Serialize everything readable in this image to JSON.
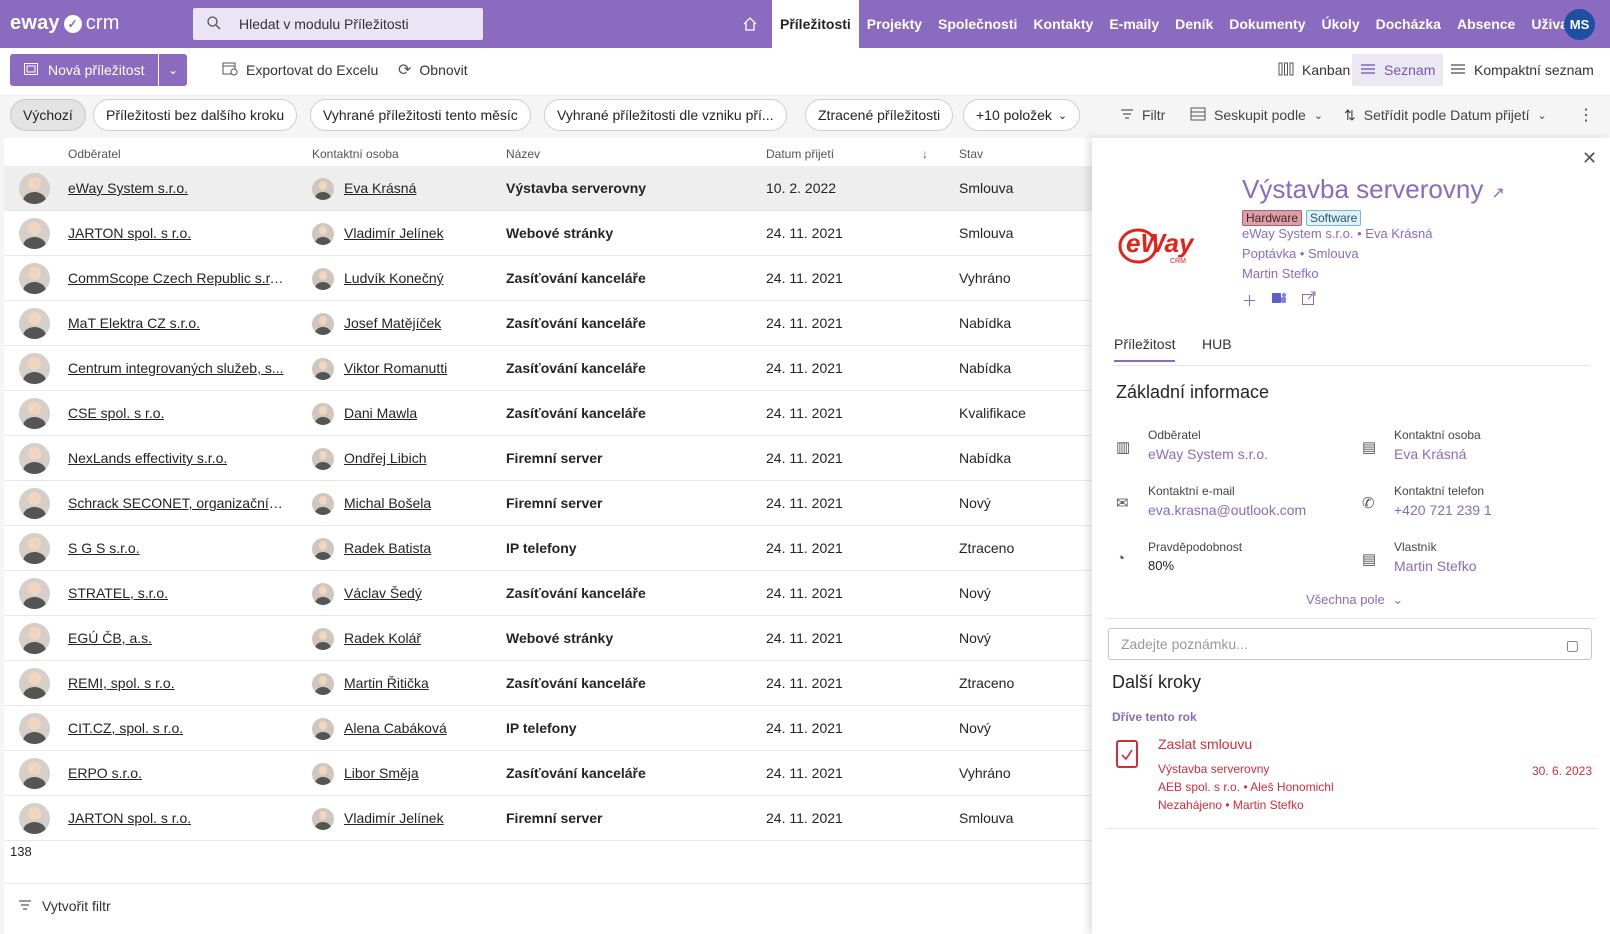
{
  "app": {
    "logo_word": "eway",
    "logo_suffix": "crm"
  },
  "search": {
    "placeholder": "Hledat v modulu Příležitosti"
  },
  "nav": {
    "items": [
      "Příležitosti",
      "Projekty",
      "Společnosti",
      "Kontakty",
      "E-maily",
      "Deník",
      "Dokumenty",
      "Úkoly",
      "Docházka",
      "Absence",
      "Uživatelé"
    ],
    "active": "Příležitosti",
    "user_initials": "MS"
  },
  "toolbar": {
    "new_label": "Nová příležitost",
    "export_label": "Exportovat do Excelu",
    "refresh_label": "Obnovit",
    "views": [
      "Kanban",
      "Seznam",
      "Kompaktní seznam"
    ],
    "active_view": "Seznam"
  },
  "filters": {
    "chips": [
      "Výchozí",
      "Příležitosti bez dalšího kroku",
      "Vyhrané příležitosti tento měsíc",
      "Vyhrané příležitosti dle vzniku pří...",
      "Ztracené příležitosti",
      "+10 položek"
    ],
    "filter_label": "Filtr",
    "group_label": "Seskupit podle",
    "sort_label": "Setřídit podle Datum přijetí"
  },
  "grid": {
    "columns": [
      "Odběratel",
      "Kontaktní osoba",
      "Název",
      "Datum přijetí",
      "Stav"
    ],
    "rows": [
      {
        "company": "eWay System s.r.o.",
        "contact": "Eva Krásná",
        "title": "Výstavba serverovny",
        "date": "10. 2. 2022",
        "state": "Smlouva"
      },
      {
        "company": "JARTON spol. s r.o.",
        "contact": "Vladimír Jelínek",
        "title": "Webové stránky",
        "date": "24. 11. 2021",
        "state": "Smlouva"
      },
      {
        "company": "CommScope Czech Republic s.r.o.",
        "contact": "Ludvík Konečný",
        "title": "Zasíťování kanceláře",
        "date": "24. 11. 2021",
        "state": "Vyhráno"
      },
      {
        "company": "MaT Elektra CZ s.r.o.",
        "contact": "Josef Matějíček",
        "title": "Zasíťování kanceláře",
        "date": "24. 11. 2021",
        "state": "Nabídka"
      },
      {
        "company": "Centrum integrovaných služeb, s...",
        "contact": "Viktor Romanutti",
        "title": "Zasíťování kanceláře",
        "date": "24. 11. 2021",
        "state": "Nabídka"
      },
      {
        "company": "CSE spol. s r.o.",
        "contact": "Dani Mawla",
        "title": "Zasíťování kanceláře",
        "date": "24. 11. 2021",
        "state": "Kvalifikace"
      },
      {
        "company": "NexLands effectivity s.r.o.",
        "contact": "Ondřej Libich",
        "title": "Firemní server",
        "date": "24. 11. 2021",
        "state": "Nabídka"
      },
      {
        "company": "Schrack SECONET, organizační sl...",
        "contact": "Michal Bošela",
        "title": "Firemní server",
        "date": "24. 11. 2021",
        "state": "Nový"
      },
      {
        "company": "S G S s.r.o.",
        "contact": "Radek Batista",
        "title": "IP telefony",
        "date": "24. 11. 2021",
        "state": "Ztraceno"
      },
      {
        "company": "STRATEL, s.r.o.",
        "contact": "Václav Šedý",
        "title": "Zasíťování kanceláře",
        "date": "24. 11. 2021",
        "state": "Nový"
      },
      {
        "company": "EGÚ ČB, a.s.",
        "contact": "Radek Kolář",
        "title": "Webové stránky",
        "date": "24. 11. 2021",
        "state": "Nový"
      },
      {
        "company": "REMI, spol. s r.o.",
        "contact": "Martin Řitička",
        "title": "Zasíťování kanceláře",
        "date": "24. 11. 2021",
        "state": "Ztraceno"
      },
      {
        "company": "CIT.CZ, spol. s r.o.",
        "contact": "Alena Cabáková",
        "title": "IP telefony",
        "date": "24. 11. 2021",
        "state": "Nový"
      },
      {
        "company": "ERPO s.r.o.",
        "contact": "Libor Směja",
        "title": "Zasíťování kanceláře",
        "date": "24. 11. 2021",
        "state": "Vyhráno"
      },
      {
        "company": "JARTON spol. s r.o.",
        "contact": "Vladimír Jelínek",
        "title": "Firemní server",
        "date": "24. 11. 2021",
        "state": "Smlouva"
      }
    ],
    "count": "138",
    "create_filter_label": "Vytvořit filtr"
  },
  "detail": {
    "title": "Výstavba serverovny",
    "logo_text": "eWay",
    "logo_sub": "CRM",
    "tags": [
      "Hardware",
      "Software"
    ],
    "meta_company": "eWay System s.r.o.",
    "meta_contact": "Eva Krásná",
    "meta_stage": "Poptávka",
    "meta_state": "Smlouva",
    "meta_owner": "Martin Stefko",
    "tabs": [
      "Příležitost",
      "HUB"
    ],
    "section_title": "Základní informace",
    "fields": {
      "customer_label": "Odběratel",
      "customer_value": "eWay System s.r.o.",
      "contact_label": "Kontaktní osoba",
      "contact_value": "Eva Krásná",
      "email_label": "Kontaktní e-mail",
      "email_value": "eva.krasna@outlook.com",
      "phone_label": "Kontaktní telefon",
      "phone_value": "+420 721 239 1",
      "prob_label": "Pravděpodobnost",
      "prob_value": "80%",
      "owner_label": "Vlastník",
      "owner_value": "Martin Stefko"
    },
    "all_fields_label": "Všechna pole",
    "note_placeholder": "Zadejte poznámku...",
    "next_steps_title": "Další kroky",
    "earlier_label": "Dříve tento rok",
    "task": {
      "name": "Zaslat smlouvu",
      "line1": "Výstavba serverovny",
      "line2": "AEB spol. s r.o. • Aleš Honomichl",
      "line3": "Nezahájeno • Martin Stefko",
      "date": "30. 6. 2023"
    }
  },
  "colors": {
    "accent": "#8b6bc0",
    "danger": "#d12d3a",
    "avatar": "#1e4fa3"
  }
}
